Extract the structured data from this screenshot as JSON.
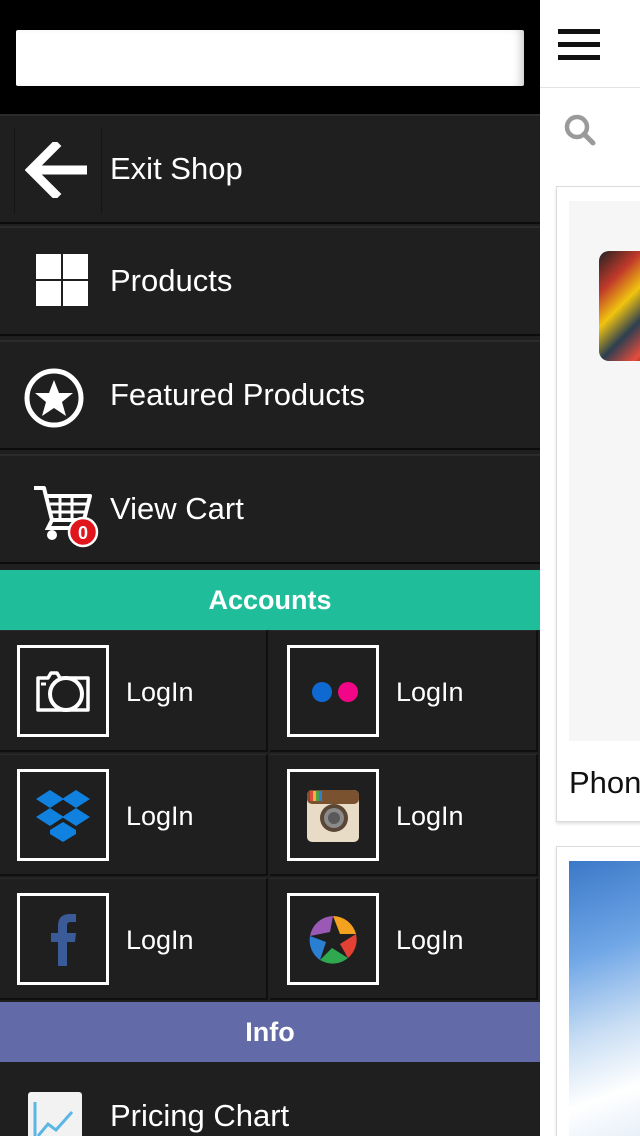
{
  "drawer": {
    "search": {
      "placeholder": "",
      "value": ""
    },
    "menu": [
      {
        "label": "Exit Shop",
        "icon": "arrow-left-icon"
      },
      {
        "label": "Products",
        "icon": "grid-icon"
      },
      {
        "label": "Featured Products",
        "icon": "star-circle-icon"
      },
      {
        "label": "View Cart",
        "icon": "cart-icon",
        "badge": "0"
      }
    ],
    "accounts": {
      "header": "Accounts",
      "items": [
        {
          "service": "camera",
          "icon": "camera-icon",
          "label": "LogIn"
        },
        {
          "service": "flickr",
          "icon": "flickr-icon",
          "label": "LogIn"
        },
        {
          "service": "dropbox",
          "icon": "dropbox-icon",
          "label": "LogIn"
        },
        {
          "service": "instagram",
          "icon": "instagram-icon",
          "label": "LogIn"
        },
        {
          "service": "facebook",
          "icon": "facebook-icon",
          "label": "LogIn"
        },
        {
          "service": "picasa",
          "icon": "picasa-icon",
          "label": "LogIn"
        }
      ]
    },
    "info": {
      "header": "Info",
      "items": [
        {
          "label": "Pricing Chart",
          "icon": "chart-icon"
        }
      ]
    }
  },
  "content": {
    "menu_icon": "hamburger-icon",
    "search_icon": "search-icon",
    "cards": [
      {
        "title": "Phon"
      },
      {
        "title": ""
      }
    ]
  },
  "colors": {
    "accounts_header": "#1fbd9a",
    "info_header": "#636aa8",
    "cart_badge": "#e0161c",
    "drawer_bg": "#1f1f1f"
  }
}
